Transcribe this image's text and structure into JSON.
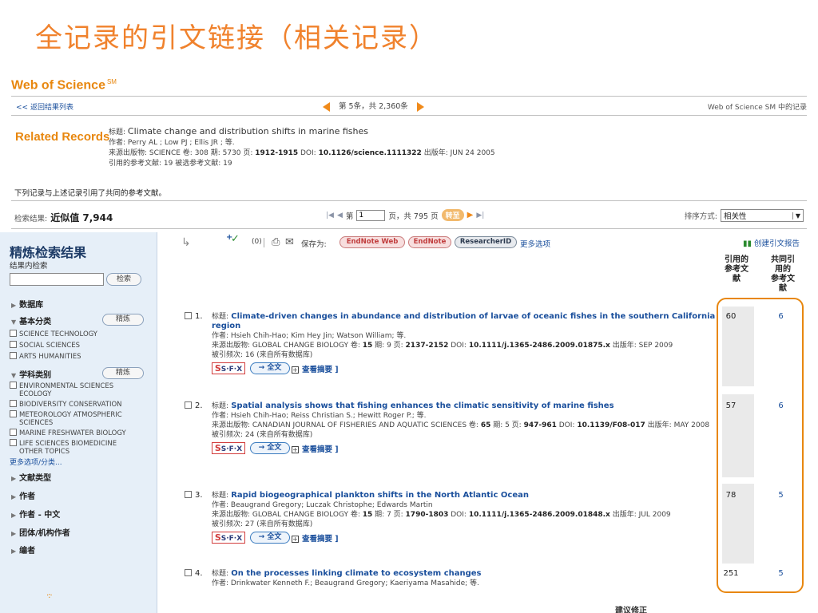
{
  "slide_title": "全记录的引文链接（相关记录）",
  "app": {
    "logo": "Web of Science",
    "logo_sup": "SM"
  },
  "nav": {
    "back": "<< 返回结果列表",
    "position": "第 5条，共 2,360条",
    "right": "Web of Science SM 中的记录"
  },
  "related": {
    "heading": "Related Records",
    "title_label": "标题:",
    "title": "Climate change and distribution shifts in marine fishes",
    "authors_line": "作者: Perry AL ; Low PJ ; Ellis JR ; 等.",
    "source_prefix": "来源出版物: SCIENCE 卷: 308 期: 5730 页: ",
    "pages": "1912-1915",
    "doi_label": " DOI: ",
    "doi": "10.1126/science.1111322",
    "date_part": " 出版年: JUN 24 2005",
    "refs_line": "引用的参考文献: 19 被选参考文献: 19"
  },
  "shared_note": "下列记录与上述记录引用了共同的参考文献。",
  "results": {
    "label": "检索结果:",
    "count": "近似值 7,944",
    "page_label": "第",
    "page_value": "1",
    "page_total": "页，共 795 页",
    "go": "转至",
    "sort_label": "排序方式:",
    "sort_value": "相关性"
  },
  "sidebar": {
    "heading": "精炼检索结果",
    "search_label": "结果内检索",
    "search_button": "检索",
    "sections": {
      "database": "数据库",
      "basic_category": "基本分类",
      "refine": "精炼",
      "subject_category": "学科类别",
      "doc_type": "文献类型",
      "author": "作者",
      "author_cn": "作者 - 中文",
      "group_author": "团体/机构作者",
      "editor": "编者"
    },
    "basic_items": [
      "SCIENCE TECHNOLOGY",
      "SOCIAL SCIENCES",
      "ARTS HUMANITIES"
    ],
    "subject_items": [
      [
        "ENVIRONMENTAL SCIENCES",
        "ECOLOGY"
      ],
      [
        "BIODIVERSITY CONSERVATION"
      ],
      [
        "METEOROLOGY ATMOSPHERIC",
        "SCIENCES"
      ],
      [
        "MARINE FRESHWATER BIOLOGY"
      ],
      [
        "LIFE SCIENCES BIOMEDICINE",
        "OTHER TOPICS"
      ]
    ],
    "more_categories": "更多选项/分类..."
  },
  "toolbar": {
    "count": "(0)",
    "save_label": "保存为:",
    "endnote_web": "EndNote Web",
    "endnote": "EndNote",
    "researcherid": "ResearcherID",
    "more_options": "更多选项",
    "citation_report": "创建引文报告"
  },
  "columns": {
    "cited_refs": [
      "引用的",
      "参考文",
      "献"
    ],
    "shared_refs": [
      "共同引",
      "用的",
      "参考文",
      "献"
    ]
  },
  "records": [
    {
      "num": "1.",
      "title_label": "标题:",
      "title": "Climate-driven changes in abundance and distribution of larvae of oceanic fishes in the southern California region",
      "authors": "作者: Hsieh Chih-Hao; Kim Hey Jin; Watson William; 等.",
      "source_prefix": "来源出版物: GLOBAL CHANGE BIOLOGY 卷: ",
      "volume": "15",
      "issue_part": " 期: 9 页: ",
      "pages": "2137-2152",
      "doi_label": " DOI: ",
      "doi": "10.1111/j.1365-2486.2009.01875.x",
      "date_part": " 出版年: SEP 2009",
      "times_cited": "被引频次: 16 (来自所有数据库)",
      "cited_refs": "60",
      "shared_refs": "6"
    },
    {
      "num": "2.",
      "title_label": "标题:",
      "title": "Spatial analysis shows that fishing enhances the climatic sensitivity of marine fishes",
      "authors": "作者: Hsieh Chih-Hao; Reiss Christian S.; Hewitt Roger P.; 等.",
      "source_prefix": "来源出版物: CANADIAN JOURNAL OF FISHERIES AND AQUATIC SCIENCES 卷: ",
      "volume": "65",
      "issue_part": " 期: 5 页: ",
      "pages": "947-961",
      "doi_label": " DOI: ",
      "doi": "10.1139/F08-017",
      "date_part": " 出版年: MAY 2008",
      "times_cited": "被引频次: 24 (来自所有数据库)",
      "cited_refs": "57",
      "shared_refs": "6"
    },
    {
      "num": "3.",
      "title_label": "标题:",
      "title": "Rapid biogeographical plankton shifts in the North Atlantic Ocean",
      "authors": "作者: Beaugrand Gregory; Luczak Christophe; Edwards Martin",
      "source_prefix": "来源出版物: GLOBAL CHANGE BIOLOGY 卷: ",
      "volume": "15",
      "issue_part": " 期: 7 页: ",
      "pages": "1790-1803",
      "doi_label": " DOI: ",
      "doi": "10.1111/j.1365-2486.2009.01848.x",
      "date_part": " 出版年: JUL 2009",
      "times_cited": "被引频次: 27 (来自所有数据库)",
      "cited_refs": "78",
      "shared_refs": "5"
    },
    {
      "num": "4.",
      "title_label": "标题:",
      "title": "On the processes linking climate to ecosystem changes",
      "authors": "作者: Drinkwater Kenneth F.; Beaugrand Gregory; Kaeriyama Masahide; 等.",
      "cited_refs": "251",
      "shared_refs": "5"
    }
  ],
  "link_labels": {
    "sfx": "S·F·X",
    "fulltext": "→ 全文",
    "abstract": "查看摘要 ]",
    "abstract_box": "+"
  },
  "bottom_clip": "建议修正",
  "colors": {
    "accent": "#e8870f",
    "link": "#1a4f9c",
    "sidebar": "#e6eff8"
  }
}
